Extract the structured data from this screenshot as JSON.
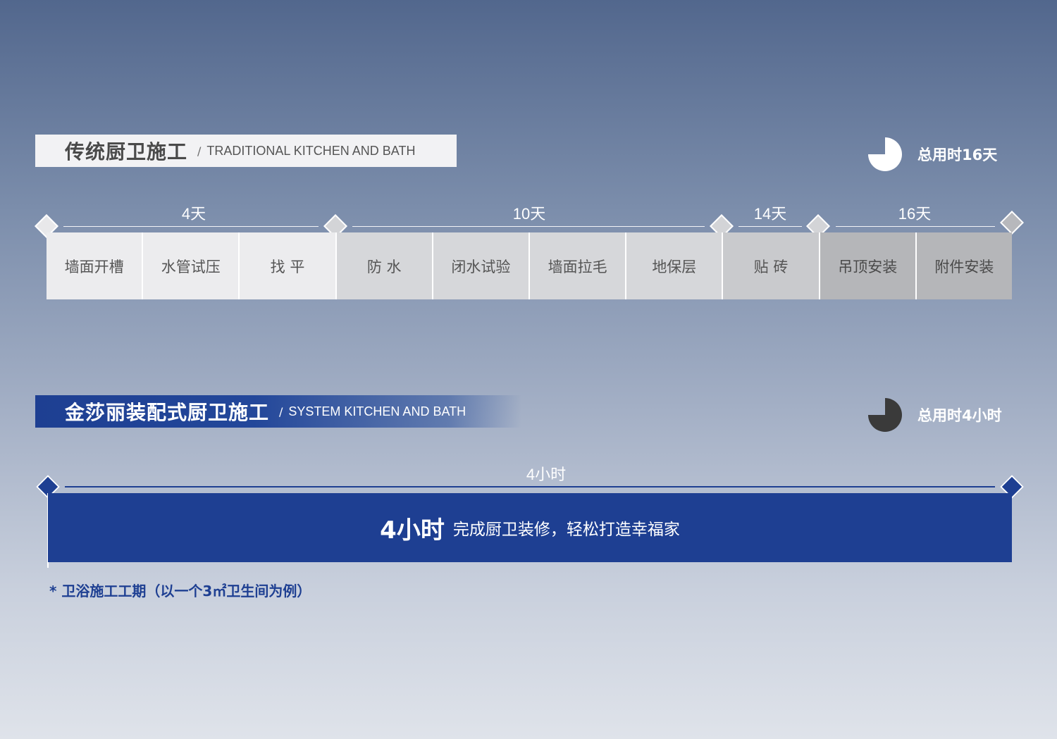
{
  "traditional": {
    "title": "传统厨卫施工",
    "separator": "/",
    "subtitle": "TRADITIONAL KITCHEN AND BATH",
    "total_label": "总用时16天",
    "milestones": [
      "4天",
      "10天",
      "14天",
      "16天"
    ],
    "steps": [
      "墙面开槽",
      "水管试压",
      "找 平",
      "防 水",
      "闭水试验",
      "墙面拉毛",
      "地保层",
      "贴 砖",
      "吊顶安装",
      "附件安装"
    ]
  },
  "system": {
    "title": "金莎丽装配式厨卫施工",
    "separator": "/",
    "subtitle": "SYSTEM KITCHEN AND BATH",
    "total_label": "总用时4小时",
    "milestone": "4小时",
    "bar_big": "4小时",
    "bar_text": "完成厨卫装修，轻松打造幸福家"
  },
  "footnote": "* 卫浴施工工期（以一个3㎡卫生间为例）",
  "colors": {
    "brand_blue": "#1e3f92",
    "step_light": "#ececee",
    "step_mid": "#d6d7da",
    "step_dark": "#b5b6b9"
  }
}
